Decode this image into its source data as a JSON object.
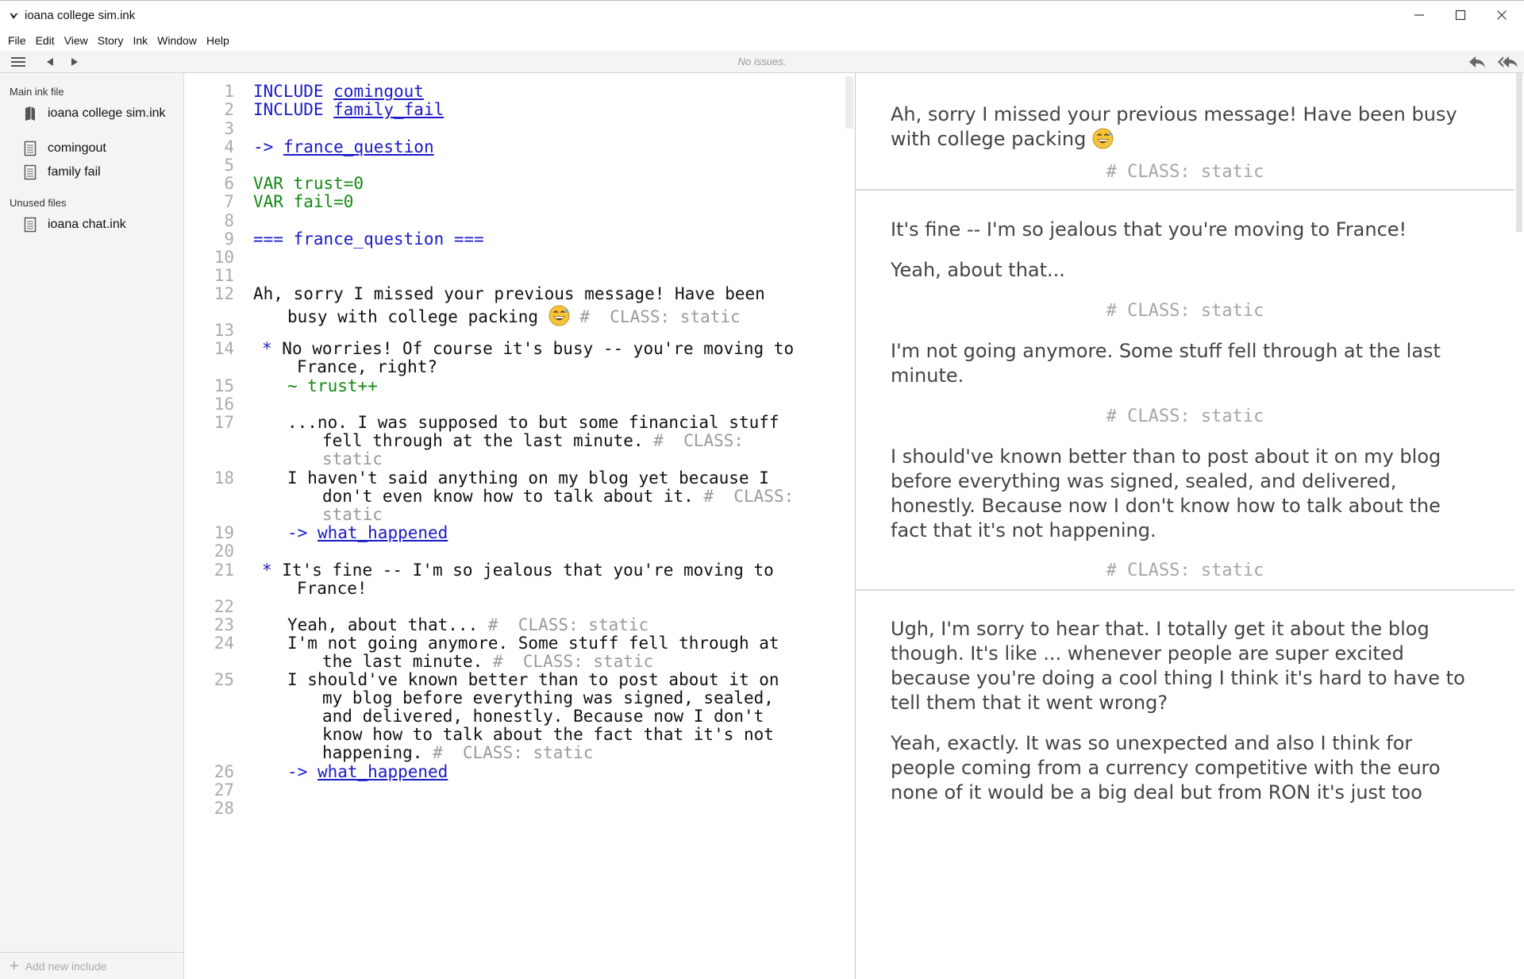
{
  "window": {
    "title": "ioana college sim.ink"
  },
  "menu": [
    "File",
    "Edit",
    "View",
    "Story",
    "Ink",
    "Window",
    "Help"
  ],
  "toolbar": {
    "status": "No issues."
  },
  "sidebar": {
    "main_label": "Main ink file",
    "main_file": "ioana college sim.ink",
    "includes": [
      "comingout",
      "family fail"
    ],
    "unused_label": "Unused files",
    "unused_files": [
      "ioana chat.ink"
    ],
    "add_include": "Add new include"
  },
  "editor": {
    "line_numbers": [
      "1",
      "2",
      "3",
      "4",
      "5",
      "6",
      "7",
      "8",
      "9",
      "10",
      "11",
      "12",
      "13",
      "14",
      "15",
      "16",
      "17",
      "18",
      "19",
      "20",
      "21",
      "22",
      "23",
      "24",
      "25",
      "26",
      "27",
      "28"
    ],
    "rows": [
      [
        {
          "t": "INCLUDE ",
          "c": "kw"
        },
        {
          "t": "comingout",
          "c": "lnk"
        }
      ],
      [
        {
          "t": "INCLUDE ",
          "c": "kw"
        },
        {
          "t": "family_fail",
          "c": "lnk"
        }
      ],
      [
        {
          "t": "-> ",
          "c": "kw"
        },
        {
          "t": "france_question",
          "c": "lnk"
        }
      ],
      [
        {
          "t": "VAR trust=0",
          "c": "var"
        }
      ],
      [
        {
          "t": "VAR fail=0",
          "c": "var"
        }
      ],
      [
        {
          "t": "=== france_question ===",
          "c": "kw"
        }
      ],
      [
        {
          "t": "Ah, sorry I missed your previous message! Have been",
          "c": ""
        }
      ],
      [
        {
          "t": "busy with college packing ",
          "c": ""
        },
        {
          "emoji": true
        },
        {
          "t": " #  CLASS: static",
          "c": "tag"
        }
      ],
      [
        {
          "t": "* ",
          "c": "kw"
        },
        {
          "t": "No worries! Of course it's busy -- you're moving to",
          "c": ""
        }
      ],
      [
        {
          "t": "France, right?",
          "c": ""
        }
      ],
      [
        {
          "t": "~ trust++",
          "c": "var"
        }
      ],
      [
        {
          "t": "...no. I was supposed to but some financial stuff",
          "c": ""
        }
      ],
      [
        {
          "t": "fell through at the last minute. ",
          "c": ""
        },
        {
          "t": "#  CLASS:",
          "c": "tag"
        }
      ],
      [
        {
          "t": "static",
          "c": "tag"
        }
      ],
      [
        {
          "t": "I haven't said anything on my blog yet because I",
          "c": ""
        }
      ],
      [
        {
          "t": "don't even know how to talk about it. ",
          "c": ""
        },
        {
          "t": "#  CLASS:",
          "c": "tag"
        }
      ],
      [
        {
          "t": "static",
          "c": "tag"
        }
      ],
      [
        {
          "t": "-> ",
          "c": "kw"
        },
        {
          "t": "what_happened",
          "c": "lnk"
        }
      ],
      [
        {
          "t": "* ",
          "c": "kw"
        },
        {
          "t": "It's fine -- I'm so jealous that you're moving to",
          "c": ""
        }
      ],
      [
        {
          "t": "France!",
          "c": ""
        }
      ],
      [
        {
          "t": "Yeah, about that... ",
          "c": ""
        },
        {
          "t": "#  CLASS: static",
          "c": "tag"
        }
      ],
      [
        {
          "t": "I'm not going anymore. Some stuff fell through at",
          "c": ""
        }
      ],
      [
        {
          "t": "the last minute. ",
          "c": ""
        },
        {
          "t": "#  CLASS: static",
          "c": "tag"
        }
      ],
      [
        {
          "t": "I should've known better than to post about it on",
          "c": ""
        }
      ],
      [
        {
          "t": "my blog before everything was signed, sealed,",
          "c": ""
        }
      ],
      [
        {
          "t": "and delivered, honestly. Because now I don't",
          "c": ""
        }
      ],
      [
        {
          "t": "know how to talk about the fact that it's not",
          "c": ""
        }
      ],
      [
        {
          "t": "happening. ",
          "c": ""
        },
        {
          "t": "#  CLASS: static",
          "c": "tag"
        }
      ],
      [
        {
          "t": "-> ",
          "c": "kw"
        },
        {
          "t": "what_happened",
          "c": "lnk"
        }
      ]
    ]
  },
  "preview": {
    "lines": [
      "Ah, sorry I missed your previous message! Have been busy",
      "with college packing",
      "It's fine -- I'm so jealous that you're moving to France!",
      "Yeah, about that...",
      "I'm not going anymore. Some stuff fell through at the last",
      "minute.",
      "I should've known better than to post about it on my blog",
      "before everything was signed, sealed, and delivered,",
      "honestly. Because now I don't know how to talk about the",
      "fact that it's not happening.",
      "Ugh, I'm sorry to hear that. I totally get it about the blog",
      "though. It's like ... whenever people are super excited",
      "because you're doing a cool thing I think it's hard to have to",
      "tell them that it went wrong?",
      "Yeah, exactly. It was so unexpected and also I think for",
      "people coming from a currency competitive with the euro",
      "none of it would be a big deal but from RON it's just too"
    ],
    "tag": "# CLASS: static"
  }
}
